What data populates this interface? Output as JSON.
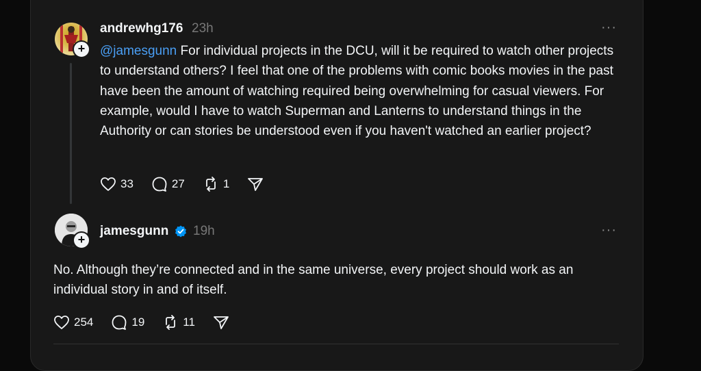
{
  "post": {
    "username": "andrewhg176",
    "time": "23h",
    "more": "···",
    "mention": "@jamesgunn",
    "text": " For individual projects in the DCU, will it be required to watch other projects to understand others? I feel that one of the problems with comic books movies in the past have been the amount of watching required being overwhelming for casual viewers. For example, would I have to watch Superman and Lanterns to understand things in the Authority or can stories be understood even if you haven't watched an earlier project?",
    "likes": "33",
    "replies": "27",
    "reposts": "1"
  },
  "reply": {
    "username": "jamesgunn",
    "verified": true,
    "time": "19h",
    "more": "···",
    "text": "No. Although they’re connected and in the same universe, every project should work as an individual story in and of itself.",
    "likes": "254",
    "replies": "19",
    "reposts": "11"
  },
  "icons": [
    "heart-icon",
    "comment-icon",
    "repost-icon",
    "share-icon",
    "verified-badge-icon",
    "follow-plus-icon",
    "more-icon"
  ],
  "colors": {
    "background": "#181818",
    "mention": "#4a9ff5",
    "verified": "#0095f6",
    "muted": "#777777"
  }
}
